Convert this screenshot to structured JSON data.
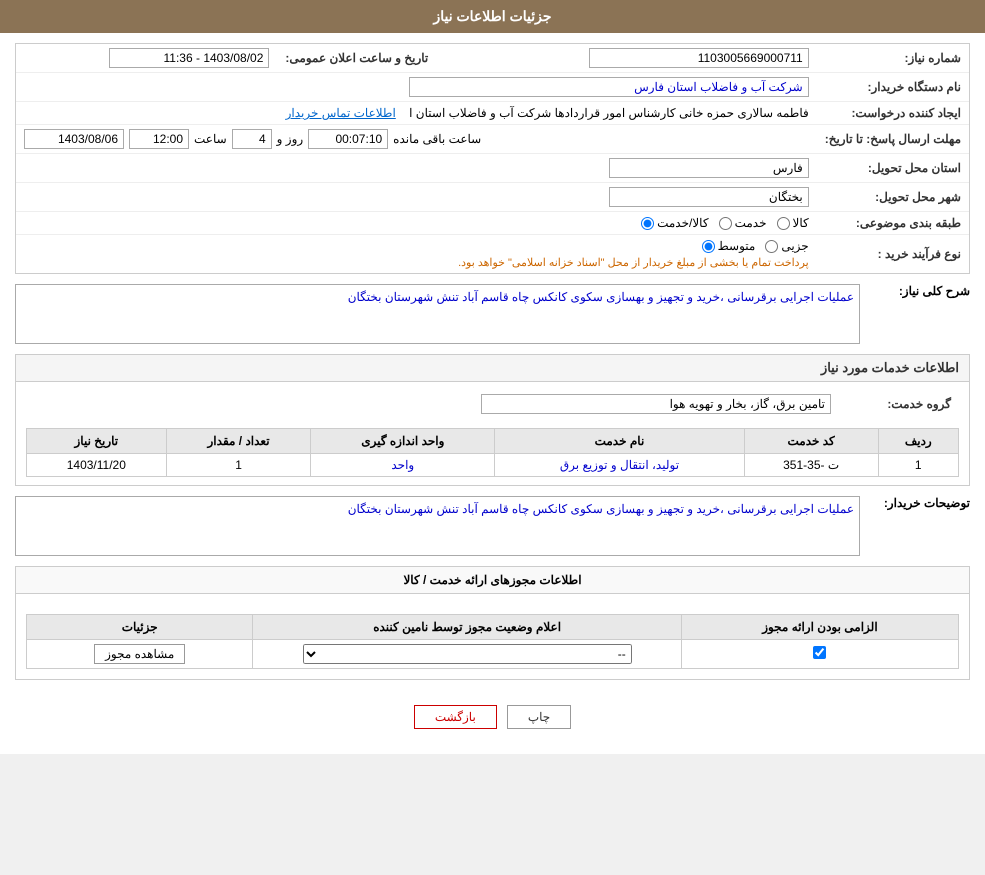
{
  "header": {
    "title": "جزئیات اطلاعات نیاز"
  },
  "info": {
    "shomara_niaz_label": "شماره نیاز:",
    "shomara_niaz_value": "1103005669000711",
    "name_dastgah_label": "نام دستگاه خریدار:",
    "name_dastgah_value": "شرکت آب و فاضلاب استان فارس",
    "tarikh_label": "تاریخ و ساعت اعلان عمومی:",
    "tarikh_value": "1403/08/02 - 11:36",
    "ijad_label": "ایجاد کننده درخواست:",
    "ijad_value": "فاطمه سالاری حمزه خانی کارشناس امور قراردادها شرکت آب و فاضلاب استان ا",
    "ijad_link": "اطلاعات تماس خریدار",
    "mohlet_label": "مهلت ارسال پاسخ: تا تاریخ:",
    "date_value": "1403/08/06",
    "time_label": "ساعت",
    "time_value": "12:00",
    "roz_label": "روز و",
    "roz_value": "4",
    "remaining_label": "ساعت باقی مانده",
    "remaining_value": "00:07:10",
    "ostan_label": "استان محل تحویل:",
    "ostan_value": "فارس",
    "shahr_label": "شهر محل تحویل:",
    "shahr_value": "بختگان",
    "tabaqe_label": "طبقه بندی موضوعی:",
    "kala_label": "کالا",
    "khedmat_label": "خدمت",
    "kala_khedmat_label": "کالا/خدمت",
    "noee_label": "نوع فرآیند خرید :",
    "jozee_label": "جزیی",
    "motavasset_label": "متوسط",
    "noee_desc": "پرداخت تمام یا بخشی از مبلغ خریدار از محل \"اسناد خزانه اسلامی\" خواهد بود."
  },
  "sharh": {
    "title": "شرح کلی نیاز:",
    "value": "عملیات اجرایی برقرسانی ،خرید و تجهیز و بهسازی سکوی کانکس چاه قاسم آباد تنش شهرستان بختگان"
  },
  "services": {
    "section_title": "اطلاعات خدمات مورد نیاز",
    "group_label": "گروه خدمت:",
    "group_value": "تامین برق، گاز، بخار و تهویه هوا",
    "table_headers": [
      "ردیف",
      "کد خدمت",
      "نام خدمت",
      "واحد اندازه گیری",
      "تعداد / مقدار",
      "تاریخ نیاز"
    ],
    "rows": [
      {
        "radif": "1",
        "code": "ت -35-351",
        "name": "تولید، انتقال و توزیع برق",
        "unit": "واحد",
        "count": "1",
        "date": "1403/11/20"
      }
    ]
  },
  "buyer_desc": {
    "label": "توضیحات خریدار:",
    "value": "عملیات اجرایی برقرسانی ،خرید و تجهیز و بهسازی سکوی کانکس چاه قاسم آباد تنش شهرستان بختگان"
  },
  "license_section": {
    "title": "اطلاعات مجوزهای ارائه خدمت / کالا",
    "table_headers": [
      "الزامی بودن ارائه مجوز",
      "اعلام وضعیت مجوز توسط نامین کننده",
      "جزئیات"
    ],
    "rows": [
      {
        "required": true,
        "status": "--",
        "detail_btn": "مشاهده مجوز"
      }
    ]
  },
  "buttons": {
    "print": "چاپ",
    "back": "بازگشت"
  }
}
